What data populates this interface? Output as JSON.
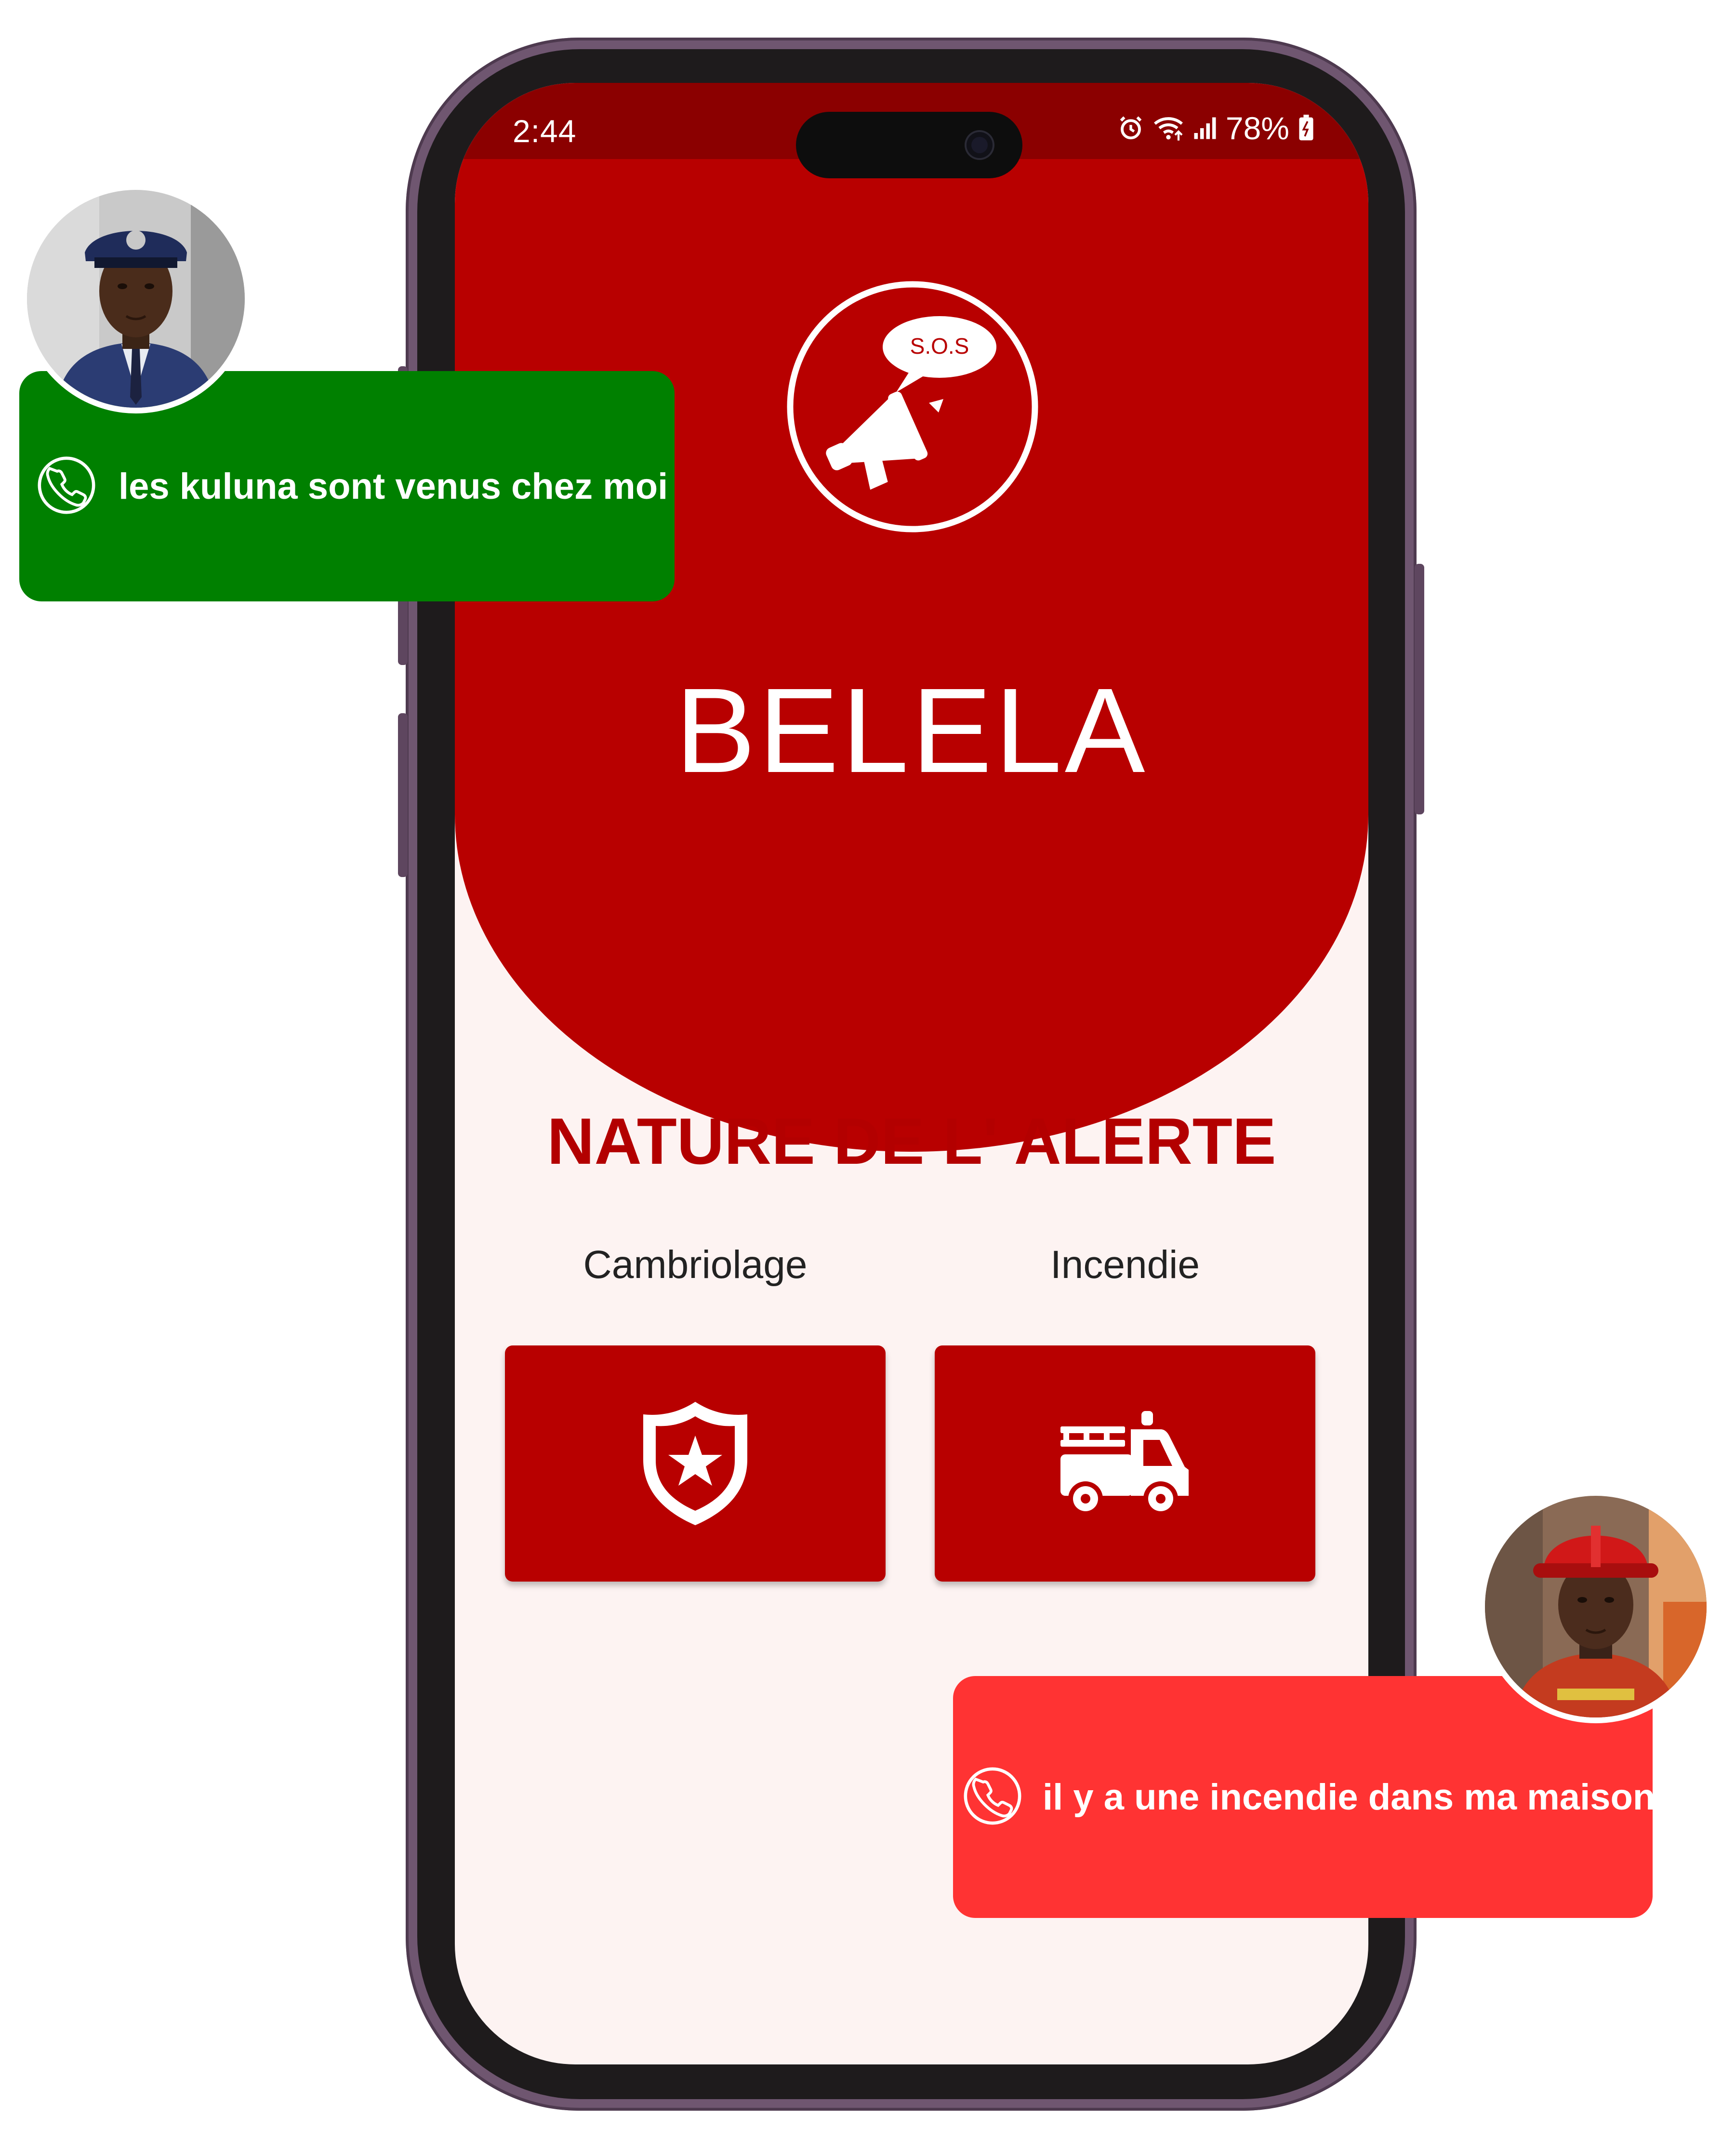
{
  "status_bar": {
    "time": "2:44",
    "battery": "78%",
    "icons": [
      "alarm-icon",
      "wifi-icon",
      "signal-icon",
      "battery-icon"
    ]
  },
  "header": {
    "logo_bubble_text": "S.O.S",
    "app_name": "BELELA",
    "logo_icon": "megaphone-icon"
  },
  "alert": {
    "title": "NATURE DE L' ALERTE",
    "categories": [
      {
        "label": "Cambriolage",
        "icon": "police-shield-icon"
      },
      {
        "label": "Incendie",
        "icon": "fire-truck-icon"
      }
    ]
  },
  "chat_bubbles": [
    {
      "text": "les kuluna sont venus chez moi",
      "color": "#008000",
      "icon": "phone-icon",
      "avatar": "police-officer-avatar"
    },
    {
      "text": "il y a une incendie dans ma maison",
      "color": "#ff3333",
      "icon": "phone-icon",
      "avatar": "firefighter-avatar"
    }
  ],
  "colors": {
    "primary": "#b80000",
    "status_bar": "#8b0000",
    "background": "#fdf3f2",
    "title_text": "#b30000",
    "phone_frame": "#6f5670"
  }
}
